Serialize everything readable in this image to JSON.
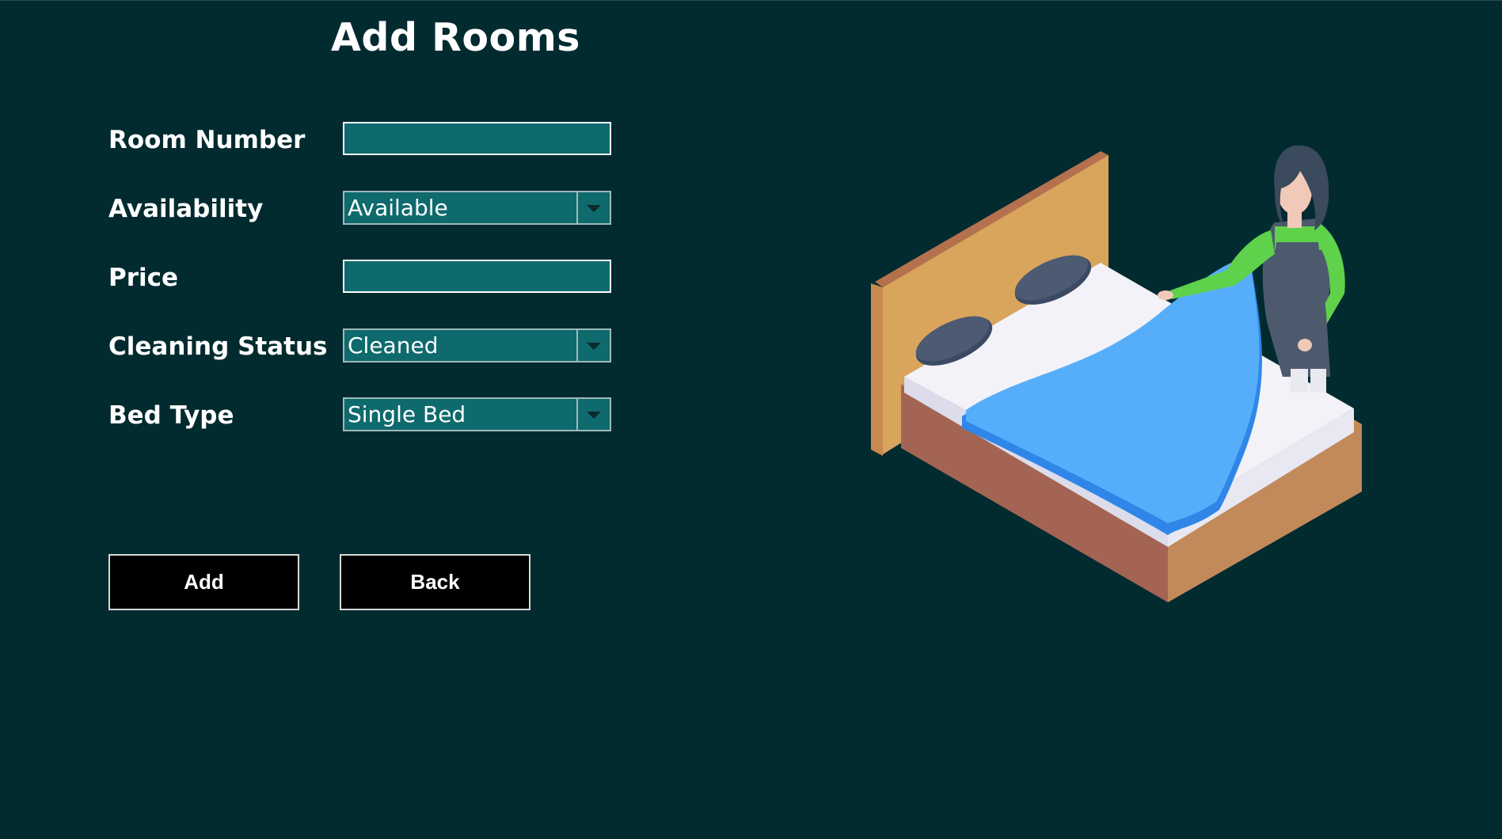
{
  "title": "Add Rooms",
  "form": {
    "room_number": {
      "label": "Room Number",
      "value": ""
    },
    "availability": {
      "label": "Availability",
      "selected": "Available"
    },
    "price": {
      "label": "Price",
      "value": ""
    },
    "cleaning_status": {
      "label": "Cleaning Status",
      "selected": "Cleaned"
    },
    "bed_type": {
      "label": "Bed Type",
      "selected": "Single Bed"
    }
  },
  "buttons": {
    "add_label": "Add",
    "back_label": "Back"
  },
  "colors": {
    "background": "#022b30",
    "field": "#0e6a6c",
    "button": "#000000"
  },
  "icons": {
    "dropdown": "chevron-down-icon",
    "illustration": "housekeeper-making-bed-illustration"
  }
}
